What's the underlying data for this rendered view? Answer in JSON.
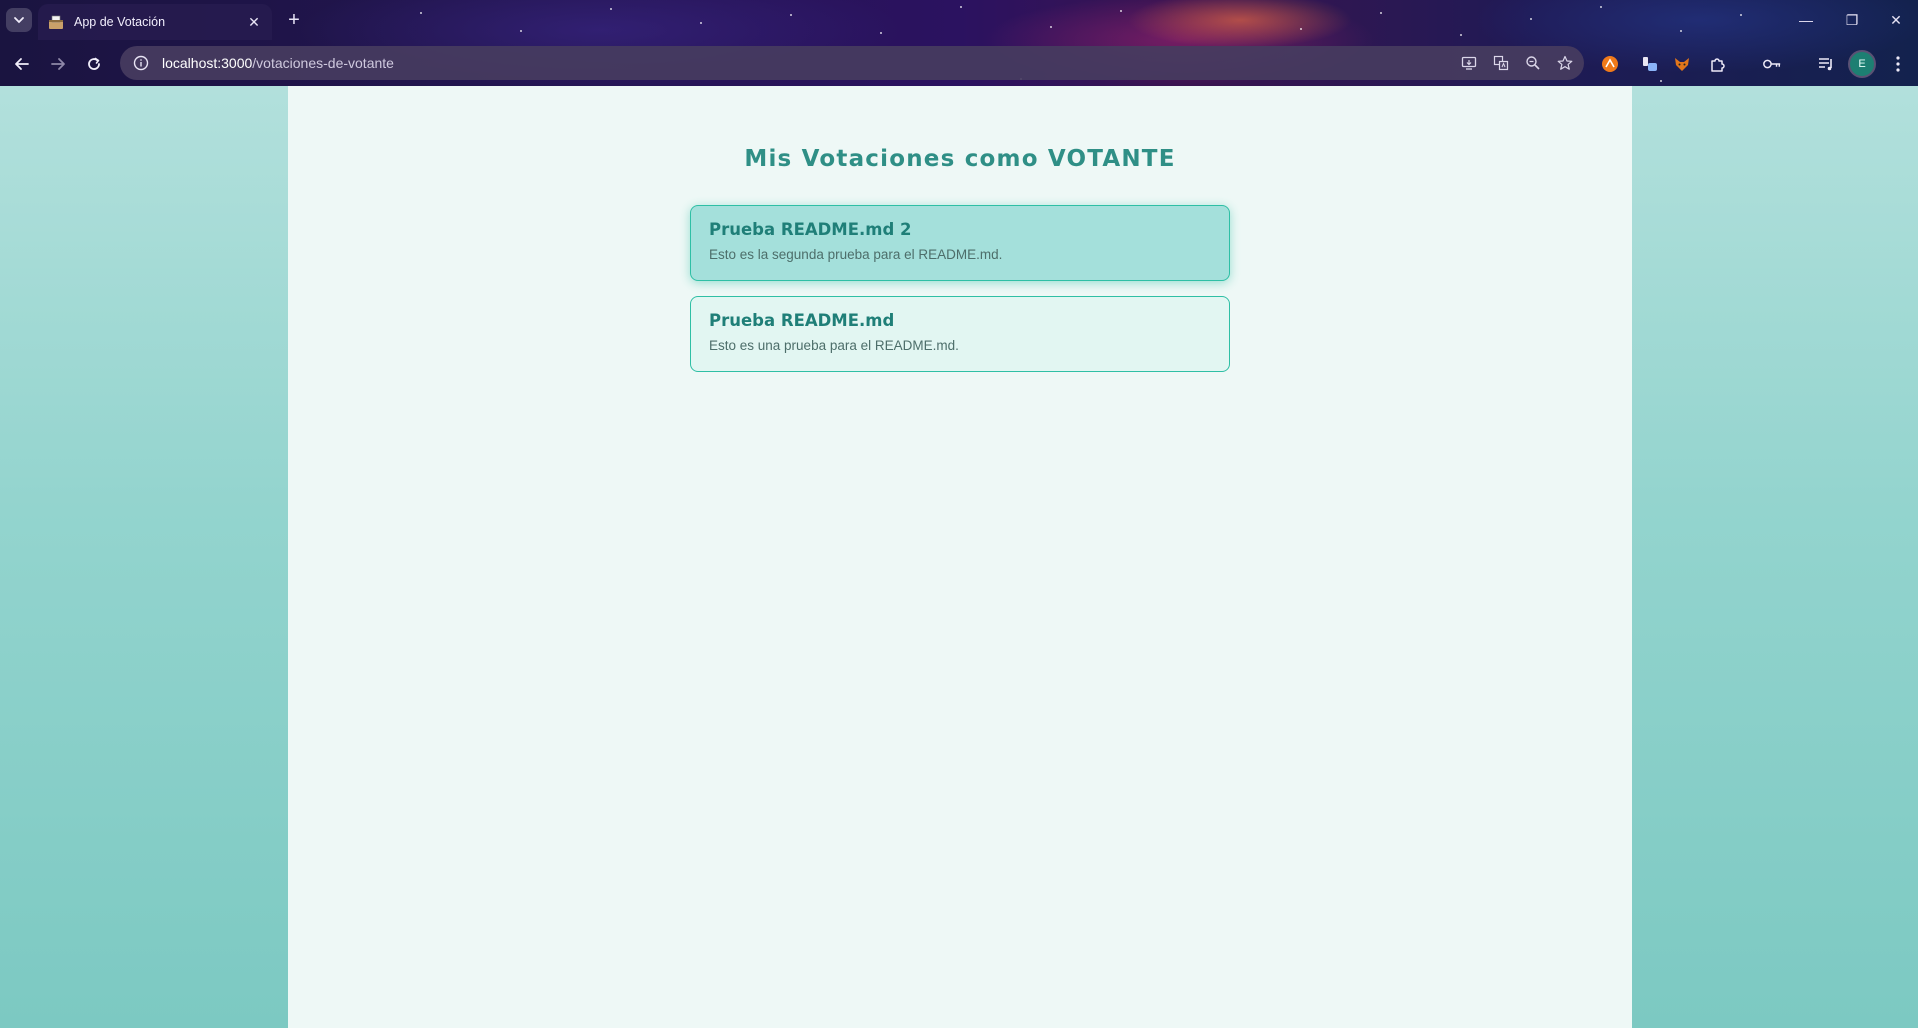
{
  "browser": {
    "tab": {
      "title": "App de Votación",
      "close_symbol": "✕"
    },
    "new_tab_symbol": "+",
    "window_controls": {
      "minimize": "—",
      "restore": "❐",
      "close": "✕"
    },
    "address": {
      "host": "localhost:3000",
      "path": "/votaciones-de-votante"
    },
    "profile_initial": "E"
  },
  "page": {
    "title": "Mis Votaciones como VOTANTE",
    "votaciones": [
      {
        "title": "Prueba README.md 2",
        "description": "Esto es la segunda prueba para el README.md."
      },
      {
        "title": "Prueba README.md",
        "description": "Esto es una prueba para el README.md."
      }
    ]
  },
  "colors": {
    "accent": "#2fbfa5",
    "title": "#2f8f86",
    "card_active_bg": "#a4e0db",
    "card_bg": "#e2f6f2",
    "content_bg": "#eef8f6"
  }
}
